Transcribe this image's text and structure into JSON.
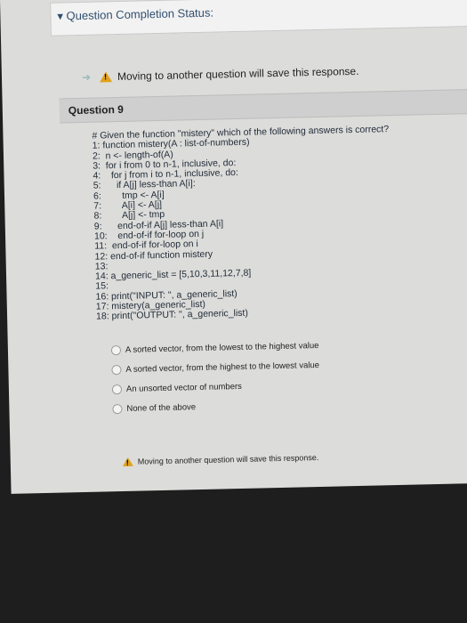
{
  "header": {
    "status_title": "Question Completion Status:"
  },
  "warning": {
    "top_text": "Moving to another question will save this response.",
    "bottom_text": "Moving to another question will save this response."
  },
  "question": {
    "title": "Question 9",
    "code_lines": [
      "# Given the function \"mistery\" which of the following answers is correct?",
      "1: function mistery(A : list-of-numbers)",
      "2:  n <- length-of(A)",
      "3:  for i from 0 to n-1, inclusive, do:",
      "4:    for j from i to n-1, inclusive, do:",
      "5:      if A[j] less-than A[i]:",
      "6:        tmp <- A[i]",
      "7:        A[i] <- A[j]",
      "8:        A[j] <- tmp",
      "9:      end-of-if A[j] less-than A[i]",
      "10:    end-of-if for-loop on j",
      "11:  end-of-if for-loop on i",
      "12: end-of-if function mistery",
      "13:",
      "14: a_generic_list = [5,10,3,11,12,7,8]",
      "15:",
      "16: print(\"INPUT: \", a_generic_list)",
      "17: mistery(a_generic_list)",
      "18: print(\"OUTPUT: \", a_generic_list)"
    ],
    "options": [
      "A sorted vector, from the lowest to the highest value",
      "A sorted vector, from the highest to the lowest value",
      "An unsorted vector of numbers",
      "None of the above"
    ]
  }
}
